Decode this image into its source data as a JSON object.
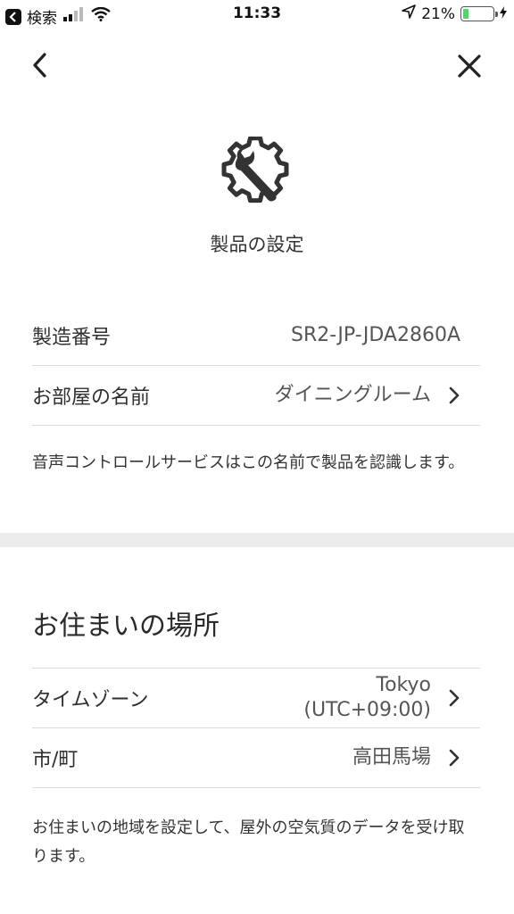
{
  "status_bar": {
    "back_app_label": "検索",
    "time": "11:33",
    "battery_percent_label": "21%",
    "battery_level": 0.21
  },
  "header": {
    "back_icon": "chevron-left-icon",
    "close_icon": "close-icon"
  },
  "hero": {
    "icon": "gear-wrench-icon",
    "title": "製品の設定"
  },
  "product": {
    "serial_label": "製造番号",
    "serial_value": "SR2-JP-JDA2860A",
    "room_label": "お部屋の名前",
    "room_value": "ダイニングルーム",
    "note": "音声コントロールサービスはこの名前で製品を認識します。"
  },
  "location": {
    "title": "お住まいの場所",
    "timezone_label": "タイムゾーン",
    "timezone_city": "Tokyo",
    "timezone_offset": "(UTC+09:00)",
    "city_label": "市/町",
    "city_value": "高田馬場",
    "note": "お住まいの地域を設定して、屋外の空気質のデータを受け取ります。"
  },
  "colors": {
    "battery_fill": "#4cd964",
    "divider_band": "#ececec",
    "text": "#2b2b2b"
  }
}
